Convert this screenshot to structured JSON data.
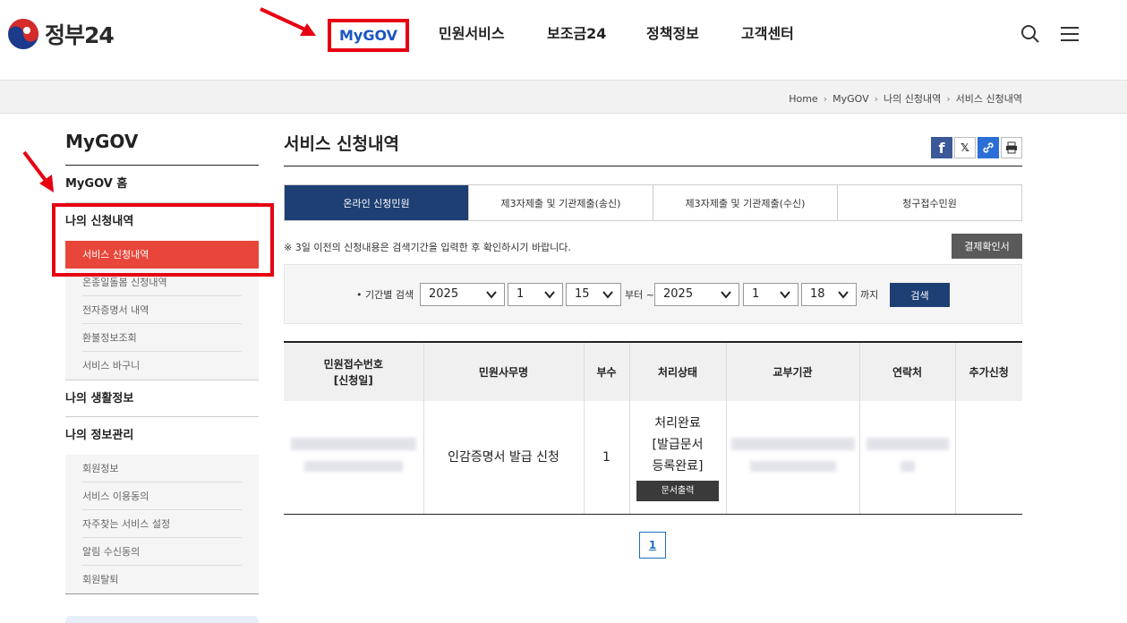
{
  "header": {
    "logo_text": "정부24",
    "nav": [
      "MyGOV",
      "민원서비스",
      "보조금24",
      "정책정보",
      "고객센터"
    ]
  },
  "breadcrumb": [
    "Home",
    "MyGOV",
    "나의 신청내역",
    "서비스 신청내역"
  ],
  "sidebar": {
    "title": "MyGOV",
    "home": "MyGOV 홈",
    "section1": "나의 신청내역",
    "section1_items": [
      "서비스 신청내역",
      "온종일돌봄 신청내역",
      "전자증명서 내역",
      "환불정보조회",
      "서비스 바구니"
    ],
    "section2": "나의 생활정보",
    "section3": "나의 정보관리",
    "section3_items": [
      "회원정보",
      "서비스 이용동의",
      "자주찾는 서비스 설정",
      "알림 수신동의",
      "회원탈퇴"
    ]
  },
  "content": {
    "title": "서비스 신청내역",
    "tabs": [
      "온라인 신청민원",
      "제3자제출 및 기관제출(송신)",
      "제3자제출 및 기관제출(수신)",
      "청구접수민원"
    ],
    "notice": "※ 3일 이전의 신청내용은 검색기간을 입력한 후 확인하시기 바랍니다.",
    "payment_button": "결제확인서",
    "search": {
      "label": "• 기간별 검색",
      "from_year": "2025",
      "from_month": "1",
      "from_day": "15",
      "from_text": "부터 ~",
      "to_year": "2025",
      "to_month": "1",
      "to_day": "18",
      "to_text": "까지",
      "button": "검색"
    },
    "table": {
      "headers": [
        "민원접수번호\n[신청일]",
        "민원사무명",
        "부수",
        "처리상태",
        "교부기관",
        "연락처",
        "추가신청"
      ],
      "rows": [
        {
          "name": "인감증명서 발급 신청",
          "count": "1",
          "status": "처리완료\n[발급문서\n등록완료]",
          "print_button": "문서출력"
        }
      ]
    },
    "page": "1"
  },
  "colors": {
    "accent": "#1e3f74",
    "active_red": "#e8463a",
    "annotation_red": "#e60012"
  }
}
